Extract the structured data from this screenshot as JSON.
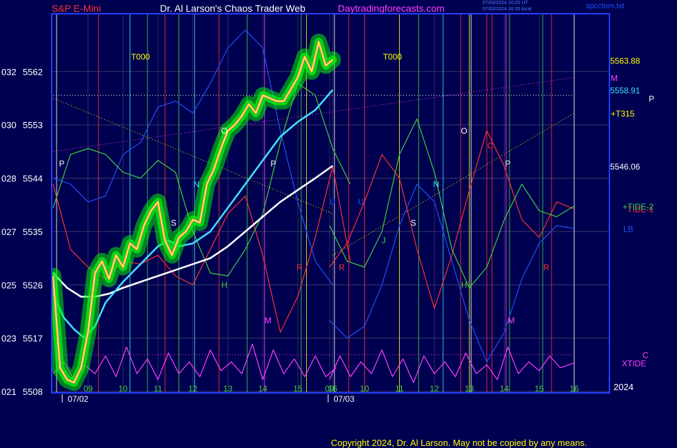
{
  "header": {
    "instrument": "S&P E-Mini",
    "title": "Dr. Al Larson's Chaos Trader Web",
    "site": "Daytradingforecasts.com",
    "stamp_utc": "07/03/2024 20:20 UT",
    "stamp_local": "07/03/2024 16:20 local",
    "file": "spcctom.txt"
  },
  "copyright": "Copyright 2024, Dr. Al Larson. May not be copied by any means.",
  "colors": {
    "background": "#000050",
    "plot_border": "#2040ff",
    "price": "#ffff00",
    "glow": "#00ff00",
    "ema_fast": "#40e0ff",
    "ema_slow": "#ffffff",
    "tide": "#ff3030",
    "tide2": "#40d040",
    "xtide": "#ff40ff",
    "lb": "#2050ff"
  },
  "chart_data": {
    "type": "line",
    "title": "S&P E-Mini",
    "ylim": [
      5508,
      5570
    ],
    "yticks": [
      {
        "left": "021",
        "price": "5508",
        "value": 5508
      },
      {
        "left": "023",
        "price": "5517",
        "value": 5517
      },
      {
        "left": "025",
        "price": "5526",
        "value": 5526
      },
      {
        "left": "027",
        "price": "5535",
        "value": 5535
      },
      {
        "left": "028",
        "price": "5544",
        "value": 5544
      },
      {
        "left": "030",
        "price": "5553",
        "value": 5553
      },
      {
        "left": "032",
        "price": "5562",
        "value": 5562
      }
    ],
    "date_labels": [
      {
        "label": "07/02",
        "hour": 8.3
      },
      {
        "label": "07/03",
        "hour": 33.0
      }
    ],
    "hour_ticks": [
      {
        "label": "09",
        "hour": 9
      },
      {
        "label": "10",
        "hour": 10
      },
      {
        "label": "11",
        "hour": 11
      },
      {
        "label": "12",
        "hour": 12
      },
      {
        "label": "13",
        "hour": 13
      },
      {
        "label": "14",
        "hour": 14
      },
      {
        "label": "15",
        "hour": 15
      },
      {
        "label": "16",
        "hour": 16
      },
      {
        "label": "09",
        "hour": 33
      },
      {
        "label": "10",
        "hour": 34
      },
      {
        "label": "11",
        "hour": 35
      },
      {
        "label": "12",
        "hour": 36
      },
      {
        "label": "13",
        "hour": 37
      },
      {
        "label": "14",
        "hour": 38
      },
      {
        "label": "15",
        "hour": 39
      },
      {
        "label": "16",
        "hour": 40
      }
    ],
    "year_label": "2024",
    "right_levels": [
      {
        "label": "5563.88",
        "value": 5563.88,
        "color": "#ffff00"
      },
      {
        "label": "5558.91",
        "value": 5558.91,
        "color": "#40e0ff"
      },
      {
        "label": "5546.06",
        "value": 5546.06,
        "color": "#ffffff"
      }
    ],
    "right_tags": [
      {
        "label": "M",
        "value": 5561.0,
        "color": "#ff40ff"
      },
      {
        "label": "P",
        "value": 5557.5,
        "color": "#ffffff"
      },
      {
        "label": "+T315",
        "value": 5555.0,
        "color": "#ffff00"
      },
      {
        "label": "TIDE-1",
        "value": 5538.8,
        "color": "#ff3030"
      },
      {
        "label": "+TIDE-2",
        "value": 5539.3,
        "color": "#40d040"
      },
      {
        "label": "LB",
        "value": 5535.5,
        "color": "#2050ff"
      },
      {
        "label": "C",
        "value": 5514.2,
        "color": "#ff40ff"
      },
      {
        "label": "XTIDE",
        "value": 5512.8,
        "color": "#ff40ff"
      }
    ],
    "vertical_lines": [
      {
        "hour": 8.1,
        "color": "#ffffff"
      },
      {
        "hour": 9.3,
        "color": "#ff3030"
      },
      {
        "hour": 10.2,
        "color": "#40e0ff"
      },
      {
        "hour": 10.7,
        "color": "#40d040"
      },
      {
        "hour": 11.2,
        "color": "#ff3030"
      },
      {
        "hour": 11.6,
        "color": "#40d040"
      },
      {
        "hour": 12.05,
        "color": "#40e0ff"
      },
      {
        "hour": 12.75,
        "color": "#ff3030"
      },
      {
        "hour": 13.55,
        "color": "#40d040"
      },
      {
        "hour": 14.05,
        "color": "#ff40ff"
      },
      {
        "hour": 15.1,
        "color": "#40d040"
      },
      {
        "hour": 15.25,
        "color": "#ffff00"
      },
      {
        "hour": 16.05,
        "color": "#ffffff"
      },
      {
        "hour": 33.55,
        "color": "#ff3030"
      },
      {
        "hour": 34.0,
        "color": "#ff3030"
      },
      {
        "hour": 35.0,
        "color": "#ffff00"
      },
      {
        "hour": 35.55,
        "color": "#40d040"
      },
      {
        "hour": 36.25,
        "color": "#40e0ff"
      },
      {
        "hour": 36.75,
        "color": "#ff3030"
      },
      {
        "hour": 37.0,
        "color": "#ffff00"
      },
      {
        "hour": 37.05,
        "color": "#ffffff"
      },
      {
        "hour": 37.5,
        "color": "#ff3030"
      },
      {
        "hour": 37.65,
        "color": "#ff3030"
      },
      {
        "hour": 38.05,
        "color": "#ff40ff"
      },
      {
        "hour": 38.15,
        "color": "#40d040"
      },
      {
        "hour": 39.1,
        "color": "#40d040"
      },
      {
        "hour": 39.35,
        "color": "#ff3030"
      },
      {
        "hour": 40.0,
        "color": "#ffffff"
      }
    ],
    "series": [
      {
        "name": "price",
        "color": "#ffff00",
        "glow": "#00ff00",
        "x": [
          8.0,
          8.2,
          8.4,
          8.6,
          8.8,
          9.0,
          9.2,
          9.4,
          9.6,
          9.8,
          10.0,
          10.2,
          10.4,
          10.6,
          10.8,
          11.0,
          11.2,
          11.4,
          11.6,
          11.8,
          12.0,
          12.2,
          12.4,
          12.6,
          12.8,
          13.0,
          13.2,
          13.4,
          13.6,
          13.8,
          14.0,
          14.2,
          14.4,
          14.6,
          14.8,
          15.0,
          15.2,
          15.4,
          15.6,
          15.8,
          16.0
        ],
        "y": [
          5527.5,
          5512.0,
          5510.0,
          5509.5,
          5512.0,
          5518.0,
          5528.0,
          5530.0,
          5527.0,
          5531.0,
          5529.0,
          5533.0,
          5532.0,
          5536.0,
          5538.5,
          5540.0,
          5533.5,
          5531.0,
          5534.0,
          5535.0,
          5537.0,
          5536.5,
          5543.0,
          5545.5,
          5549.0,
          5552.0,
          5553.0,
          5554.5,
          5556.5,
          5555.0,
          5558.0,
          5557.5,
          5557.0,
          5557.0,
          5559.0,
          5561.0,
          5564.5,
          5562.0,
          5567.0,
          5563.0,
          5564.0
        ]
      },
      {
        "name": "ema_fast",
        "color": "#40e0ff",
        "x": [
          8.0,
          8.3,
          8.6,
          8.9,
          9.2,
          9.5,
          10.0,
          10.5,
          11.0,
          11.3,
          11.6,
          12.0,
          12.5,
          13.0,
          13.5,
          14.0,
          14.5,
          15.0,
          15.5,
          16.0
        ],
        "y": [
          5524.5,
          5520.5,
          5518.5,
          5517.0,
          5519.0,
          5523.0,
          5526.5,
          5529.5,
          5532.5,
          5533.5,
          5532.5,
          5533.0,
          5535.0,
          5539.0,
          5543.0,
          5547.0,
          5551.0,
          5553.5,
          5555.5,
          5558.9
        ]
      },
      {
        "name": "ema_slow",
        "color": "#ffffff",
        "x": [
          8.0,
          8.4,
          8.8,
          9.2,
          9.6,
          10.0,
          10.5,
          11.0,
          11.5,
          12.0,
          12.5,
          13.0,
          13.5,
          14.0,
          14.5,
          15.0,
          15.5,
          16.0
        ],
        "y": [
          5528.0,
          5525.5,
          5524.0,
          5524.0,
          5524.5,
          5525.5,
          5526.5,
          5527.5,
          5528.5,
          5529.5,
          5530.5,
          5532.5,
          5535.0,
          5537.5,
          5540.0,
          5542.0,
          5544.0,
          5546.1
        ]
      },
      {
        "name": "TIDE-1",
        "color": "#ff3030",
        "x": [
          8.0,
          8.5,
          9.0,
          9.5,
          10.0,
          10.5,
          11.0,
          11.5,
          12.0,
          12.5,
          13.0,
          13.5,
          14.0,
          14.5,
          15.0,
          15.5,
          16.0,
          16.5,
          33.0,
          33.5,
          34.0,
          34.5,
          35.0,
          35.5,
          36.0,
          36.5,
          37.0,
          37.5,
          38.0,
          38.5,
          39.0,
          39.5,
          40.0
        ],
        "y": [
          5543.0,
          5532.0,
          5529.0,
          5527.0,
          5530.0,
          5529.5,
          5531.0,
          5527.5,
          5526.0,
          5532.0,
          5538.0,
          5541.0,
          5531.0,
          5518.0,
          5524.0,
          5534.0,
          5546.0,
          5530.0,
          5529.0,
          5533.0,
          5540.0,
          5548.0,
          5544.0,
          5532.0,
          5522.0,
          5531.0,
          5542.0,
          5552.0,
          5546.0,
          5537.0,
          5534.0,
          5540.0,
          5538.8
        ]
      },
      {
        "name": "TIDE-2",
        "color": "#40d040",
        "x": [
          8.0,
          8.5,
          9.0,
          9.5,
          10.0,
          10.5,
          11.0,
          11.5,
          12.0,
          12.5,
          13.0,
          13.5,
          14.0,
          14.5,
          15.0,
          15.5,
          16.0,
          16.5,
          33.0,
          33.5,
          34.0,
          34.5,
          35.0,
          35.5,
          36.0,
          36.5,
          37.0,
          37.5,
          38.0,
          38.5,
          39.0,
          39.5,
          40.0
        ],
        "y": [
          5539.0,
          5548.0,
          5549.0,
          5548.0,
          5545.0,
          5544.0,
          5547.0,
          5545.0,
          5535.0,
          5528.0,
          5527.5,
          5532.0,
          5538.0,
          5550.0,
          5560.0,
          5558.0,
          5549.0,
          5543.0,
          5536.0,
          5530.0,
          5529.0,
          5535.0,
          5548.0,
          5554.0,
          5545.0,
          5532.0,
          5525.5,
          5529.0,
          5537.0,
          5543.0,
          5538.5,
          5537.5,
          5539.3
        ]
      },
      {
        "name": "LB",
        "color": "#2050ff",
        "x": [
          8.0,
          8.5,
          9.0,
          9.5,
          10.0,
          10.5,
          11.0,
          11.5,
          12.0,
          12.5,
          13.0,
          13.5,
          14.0,
          14.5,
          15.0,
          15.5,
          16.0,
          33.0,
          33.5,
          34.0,
          34.5,
          35.0,
          35.5,
          36.0,
          36.5,
          37.0,
          37.5,
          38.0,
          38.5,
          39.0,
          39.5,
          40.0
        ],
        "y": [
          5544.0,
          5543.0,
          5540.0,
          5541.0,
          5548.0,
          5550.0,
          5556.0,
          5557.0,
          5555.0,
          5560.0,
          5566.0,
          5569.0,
          5566.0,
          5552.0,
          5540.0,
          5530.0,
          5526.0,
          5520.0,
          5517.0,
          5519.0,
          5526.0,
          5536.0,
          5543.0,
          5540.0,
          5530.0,
          5520.0,
          5513.0,
          5518.0,
          5527.0,
          5533.0,
          5536.0,
          5535.5
        ]
      },
      {
        "name": "XTIDE",
        "color": "#ff40ff",
        "x": [
          8.0,
          8.3,
          8.6,
          8.9,
          9.2,
          9.5,
          9.8,
          10.1,
          10.4,
          10.7,
          11.0,
          11.3,
          11.6,
          11.9,
          12.2,
          12.5,
          12.8,
          13.1,
          13.4,
          13.7,
          14.0,
          14.3,
          14.6,
          14.9,
          15.2,
          15.5,
          15.8,
          16.1,
          33.0,
          33.3,
          33.6,
          33.9,
          34.2,
          34.5,
          34.8,
          35.1,
          35.4,
          35.7,
          36.0,
          36.3,
          36.6,
          36.9,
          37.2,
          37.5,
          37.8,
          38.1,
          38.4,
          38.7,
          39.0,
          39.3,
          39.6,
          40.0
        ],
        "y": [
          5511.0,
          5513.0,
          5510.0,
          5512.5,
          5511.0,
          5514.0,
          5510.5,
          5515.5,
          5511.0,
          5513.5,
          5510.0,
          5514.5,
          5511.0,
          5513.0,
          5510.5,
          5515.0,
          5511.5,
          5513.0,
          5511.0,
          5516.0,
          5510.0,
          5515.0,
          5511.0,
          5513.5,
          5510.5,
          5514.0,
          5510.5,
          5512.0,
          5510.0,
          5514.0,
          5510.5,
          5513.0,
          5511.0,
          5515.0,
          5510.5,
          5513.5,
          5509.5,
          5514.0,
          5511.0,
          5513.0,
          5510.5,
          5514.5,
          5511.0,
          5512.5,
          5510.0,
          5515.5,
          5511.0,
          5513.0,
          5511.5,
          5514.0,
          5512.0,
          5512.8
        ]
      }
    ],
    "reference_lines": [
      {
        "name": "M",
        "color": "#ff40ff",
        "style": "dotted",
        "x": [
          8.0,
          40.0
        ],
        "y": [
          5548.5,
          5561.0
        ]
      },
      {
        "name": "+T315",
        "color": "#ffff00",
        "style": "dotted",
        "x": [
          8.0,
          16.0
        ],
        "y": [
          5557.5,
          5538.0
        ]
      },
      {
        "name": "+T315",
        "color": "#ffff00",
        "style": "dotted",
        "x": [
          16.0,
          40.0
        ],
        "y": [
          5531.0,
          5555.0
        ]
      },
      {
        "name": "P",
        "color": "#ffffff",
        "style": "dotted",
        "x": [
          8.0,
          40.0
        ],
        "y": [
          5558.0,
          5558.0
        ]
      },
      {
        "name": "C",
        "color": "#ff40ff",
        "style": "dotted",
        "x": [
          8.0,
          40.0
        ],
        "y": [
          5514.2,
          5514.2
        ]
      }
    ],
    "markers": [
      {
        "label": "T000",
        "hour": 10.5,
        "value": 5564.0,
        "color": "#ffff00"
      },
      {
        "label": "T000",
        "hour": 34.8,
        "value": 5564.0,
        "color": "#ffff00"
      },
      {
        "label": "O",
        "hour": 12.9,
        "value": 5551.5,
        "color": "#ffffff"
      },
      {
        "label": "O",
        "hour": 36.85,
        "value": 5551.5,
        "color": "#ffffff"
      },
      {
        "label": "P",
        "hour": 8.25,
        "value": 5546.0,
        "color": "#ffffff"
      },
      {
        "label": "P",
        "hour": 14.3,
        "value": 5546.0,
        "color": "#ffffff"
      },
      {
        "label": "P",
        "hour": 38.1,
        "value": 5546.0,
        "color": "#ffffff"
      },
      {
        "label": "N",
        "hour": 12.1,
        "value": 5542.5,
        "color": "#40e0ff"
      },
      {
        "label": "N",
        "hour": 36.05,
        "value": 5542.5,
        "color": "#40e0ff"
      },
      {
        "label": "S",
        "hour": 11.45,
        "value": 5536.0,
        "color": "#ffffff"
      },
      {
        "label": "S",
        "hour": 35.4,
        "value": 5536.0,
        "color": "#ffffff"
      },
      {
        "label": "H",
        "hour": 12.9,
        "value": 5525.5,
        "color": "#40d040"
      },
      {
        "label": "H",
        "hour": 36.85,
        "value": 5525.5,
        "color": "#40d040"
      },
      {
        "label": "M",
        "hour": 14.15,
        "value": 5519.5,
        "color": "#ff40ff"
      },
      {
        "label": "M",
        "hour": 38.2,
        "value": 5519.5,
        "color": "#ff40ff"
      },
      {
        "label": "R",
        "hour": 15.05,
        "value": 5528.5,
        "color": "#ff3030"
      },
      {
        "label": "R",
        "hour": 33.35,
        "value": 5528.5,
        "color": "#ff3030"
      },
      {
        "label": "R",
        "hour": 39.2,
        "value": 5528.5,
        "color": "#ff3030"
      },
      {
        "label": "U",
        "hour": 16.0,
        "value": 5539.5,
        "color": "#2050ff"
      },
      {
        "label": "U",
        "hour": 33.9,
        "value": 5539.5,
        "color": "#2050ff"
      },
      {
        "label": "J",
        "hour": 34.55,
        "value": 5533.0,
        "color": "#40d040"
      },
      {
        "label": "C",
        "hour": 37.6,
        "value": 5549.0,
        "color": "#ff3030"
      }
    ]
  }
}
